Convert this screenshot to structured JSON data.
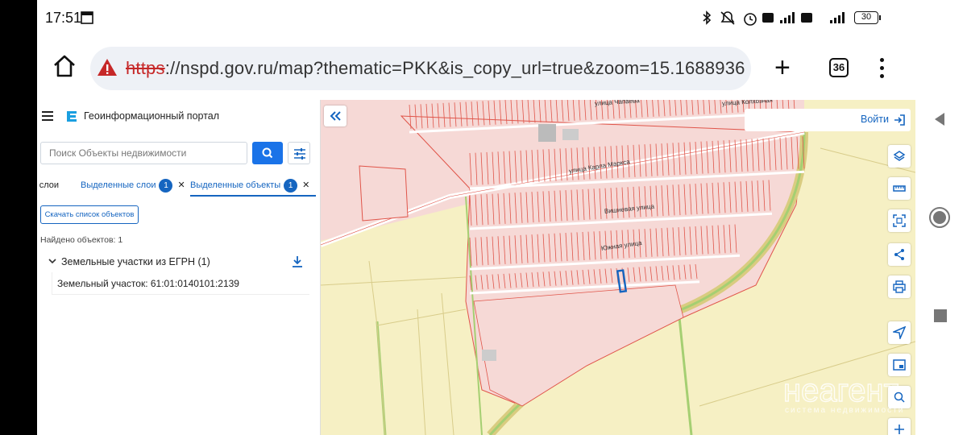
{
  "status_bar": {
    "time": "17:51",
    "battery": "30",
    "icons": [
      "bluetooth-icon",
      "mute-icon",
      "alarm-icon",
      "volte-icon",
      "signal-4g-icon",
      "volte-icon",
      "signal-icon",
      "battery-icon"
    ]
  },
  "browser": {
    "url_scheme": "https",
    "url_rest": "://nspd.gov.ru/map?thematic=PKK&is_copy_url=true&zoom=15.1688936",
    "tab_count": "36"
  },
  "panel": {
    "title": "Геоинформационный портал",
    "search_placeholder": "Поиск Объекты недвижимости",
    "tabs": [
      {
        "label": "слои"
      },
      {
        "label": "Выделенные слои",
        "badge": "1"
      },
      {
        "label": "Выделенные объекты",
        "badge": "1"
      }
    ],
    "list_button": "Скачать список объектов",
    "found": "Найдено объектов: 1",
    "group_label": "Земельные участки из ЕГРН (1)",
    "item": "Земельный участок: 61:01:0140101:2139"
  },
  "map": {
    "login": "Войти",
    "streets": [
      "улица Карла Маркса",
      "Вишневая улица",
      "Южная улица",
      "улица Чапаева",
      "улица Колхозная"
    ],
    "watermark": "неагент",
    "watermark_tag": "система недвижимости",
    "colors": {
      "parcel_fill": "#f6d9d6",
      "parcel_stroke": "#e0554a",
      "field": "#f6f0c4",
      "selected": "#1565c0"
    }
  }
}
